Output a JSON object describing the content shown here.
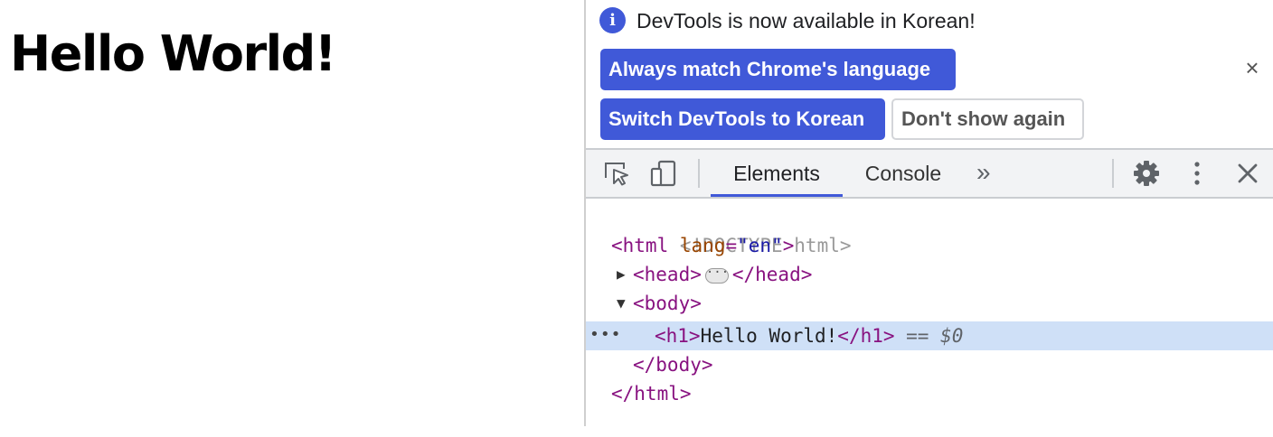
{
  "page": {
    "heading": "Hello World!"
  },
  "infobar": {
    "message": "DevTools is now available in Korean!",
    "icon": "info-icon",
    "buttons": {
      "always_match": "Always match Chrome's language",
      "switch_korean": "Switch DevTools to Korean",
      "dont_show": "Don't show again"
    },
    "close_glyph": "×"
  },
  "toolbar": {
    "tabs": [
      {
        "label": "Elements",
        "active": true
      },
      {
        "label": "Console",
        "active": false
      }
    ],
    "more_tabs": "»"
  },
  "elements_tree": {
    "doctype": "<!DOCTYPE html>",
    "html_open": "<html",
    "html_attr_name": "lang",
    "html_attr_eq": "=",
    "html_attr_value": "\"en\"",
    "html_open_close": ">",
    "head_open": "<head>",
    "head_close": "</head>",
    "body_open": "<body>",
    "h1_open": "<h1>",
    "h1_text": "Hello World!",
    "h1_close": "</h1>",
    "selected_marker": " == ",
    "selected_ref": "$0",
    "body_close": "</body>",
    "html_close": "</html>",
    "gutter_dots": "•••"
  },
  "colors": {
    "accent": "#4059d8",
    "selection": "#cfe0f7",
    "tag": "#881280",
    "attr_name": "#994500",
    "attr_value": "#1a1aa6"
  }
}
